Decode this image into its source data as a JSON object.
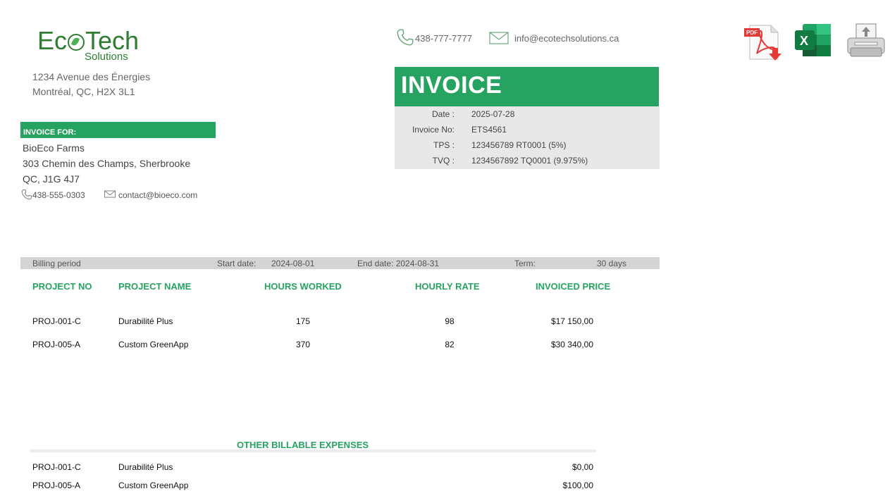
{
  "logo": {
    "main_left": "Ec",
    "main_right": "Tech",
    "sub": "Solutions"
  },
  "company": {
    "address_line1": "1234 Avenue des Énergies",
    "address_line2": "Montréal, QC, H2X 3L1",
    "phone": "438-777-7777",
    "email": "info@ecotechsolutions.ca"
  },
  "export": {
    "pdf_label": "PDF",
    "excel_label": "X"
  },
  "invoice": {
    "title": "INVOICE",
    "meta": [
      {
        "label": "Date :",
        "value": "2025-07-28"
      },
      {
        "label": "Invoice No:",
        "value": "ETS4561"
      },
      {
        "label": "TPS :",
        "value": "123456789 RT0001 (5%)"
      },
      {
        "label": "TVQ :",
        "value": "1234567892 TQ0001 (9.975%)"
      }
    ]
  },
  "client": {
    "section_label": "INVOICE FOR:",
    "name": "BioEco Farms",
    "address_line1": "303 Chemin des Champs, Sherbrooke",
    "address_line2": "QC, J1G 4J7",
    "phone": "438-555-0303",
    "email": "contact@bioeco.com"
  },
  "billing": {
    "label": "Billing period",
    "start_label": "Start date:",
    "start_value": "2024-08-01",
    "end_text": "End date: 2024-08-31",
    "term_label": "Term:",
    "term_value": "30 days"
  },
  "table": {
    "headers": [
      "PROJECT NO",
      "PROJECT NAME",
      "HOURS WORKED",
      "HOURLY RATE",
      "INVOICED PRICE"
    ],
    "rows": [
      {
        "no": "PROJ-001-C",
        "name": "Durabilité Plus",
        "hours": "175",
        "rate": "98",
        "price": "$17 150,00"
      },
      {
        "no": "PROJ-005-A",
        "name": "Custom GreenApp",
        "hours": "370",
        "rate": "82",
        "price": "$30 340,00"
      }
    ]
  },
  "other": {
    "title": "OTHER BILLABLE EXPENSES",
    "rows": [
      {
        "no": "PROJ-001-C",
        "name": "Durabilité Plus",
        "amount": "$0,00"
      },
      {
        "no": "PROJ-005-A",
        "name": "Custom GreenApp",
        "amount": "$100,00"
      }
    ]
  },
  "colors": {
    "accent": "#27a361",
    "meta_bg": "#e8e8e8",
    "billing_bg": "#d4d4d4"
  }
}
